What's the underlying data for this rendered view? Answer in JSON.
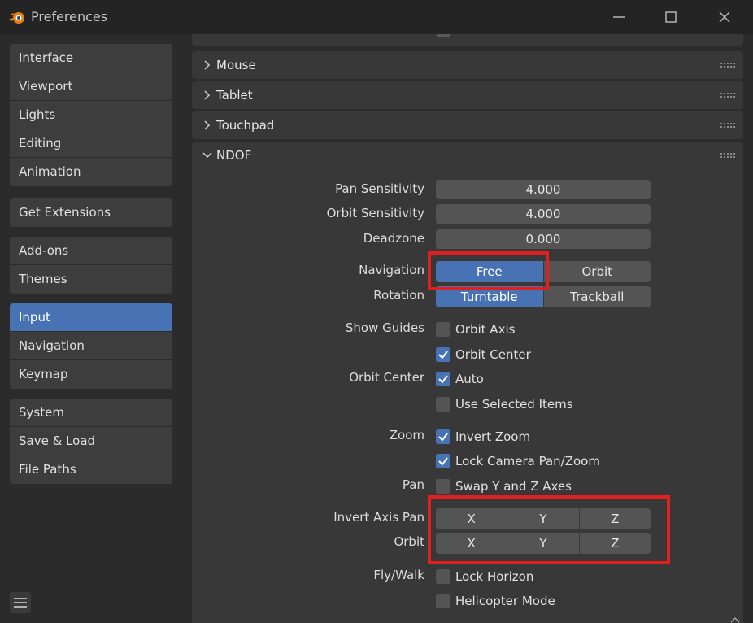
{
  "window": {
    "title": "Preferences"
  },
  "sidebar": {
    "group1": [
      "Interface",
      "Viewport",
      "Lights",
      "Editing",
      "Animation"
    ],
    "group2": [
      "Get Extensions"
    ],
    "group3": [
      "Add-ons",
      "Themes"
    ],
    "group4": [
      "Input",
      "Navigation",
      "Keymap"
    ],
    "group5": [
      "System",
      "Save & Load",
      "File Paths"
    ],
    "active": "Input"
  },
  "panels": {
    "mouse": "Mouse",
    "tablet": "Tablet",
    "touchpad": "Touchpad",
    "ndof": "NDOF"
  },
  "ndof": {
    "pan_sensitivity": {
      "label": "Pan Sensitivity",
      "value": "4.000"
    },
    "orbit_sensitivity": {
      "label": "Orbit Sensitivity",
      "value": "4.000"
    },
    "deadzone": {
      "label": "Deadzone",
      "value": "0.000"
    },
    "navigation": {
      "label": "Navigation",
      "options": [
        "Free",
        "Orbit"
      ],
      "selected": "Free"
    },
    "rotation": {
      "label": "Rotation",
      "options": [
        "Turntable",
        "Trackball"
      ],
      "selected": "Turntable"
    },
    "show_guides": {
      "label": "Show Guides",
      "orbit_axis": "Orbit Axis",
      "orbit_center": "Orbit Center"
    },
    "orbit_center": {
      "label": "Orbit Center",
      "auto": "Auto",
      "use_selected": "Use Selected Items"
    },
    "zoom": {
      "label": "Zoom",
      "invert_zoom": "Invert Zoom",
      "lock_camera": "Lock Camera Pan/Zoom"
    },
    "pan": {
      "label": "Pan",
      "swap_yz": "Swap Y and Z Axes"
    },
    "invert_axis_pan": {
      "label": "Invert Axis Pan",
      "x": "X",
      "y": "Y",
      "z": "Z"
    },
    "orbit": {
      "label": "Orbit",
      "x": "X",
      "y": "Y",
      "z": "Z"
    },
    "fly_walk": {
      "label": "Fly/Walk",
      "lock_horizon": "Lock Horizon",
      "helicopter": "Helicopter Mode"
    }
  },
  "colors": {
    "accent": "#4772b3",
    "highlight": "#e01f1f"
  }
}
